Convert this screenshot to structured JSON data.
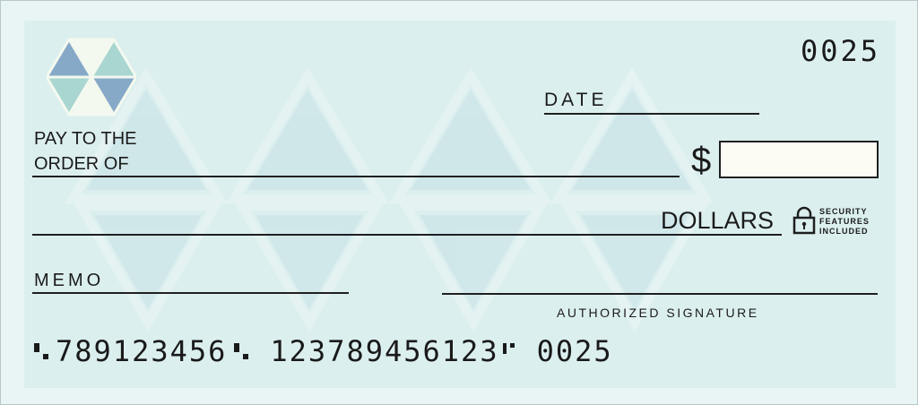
{
  "check": {
    "number": "0025",
    "date_label": "DATE",
    "pay_to_line1": "PAY TO THE",
    "pay_to_line2": "ORDER OF",
    "currency_symbol": "$",
    "dollars_label": "DOLLARS",
    "security_line1": "SECURITY",
    "security_line2": "FEATURES",
    "security_line3": "INCLUDED",
    "memo_label": "MEMO",
    "signature_label": "AUTHORIZED SIGNATURE",
    "micr": {
      "routing": "789123456",
      "account": "123789456123",
      "check_number": "0025"
    },
    "colors": {
      "background": "#dcefef",
      "pattern": "#cde5e8",
      "logo_blue": "#86a9c8",
      "logo_teal": "#a9d6d0",
      "logo_light": "#f2f8ee"
    }
  }
}
